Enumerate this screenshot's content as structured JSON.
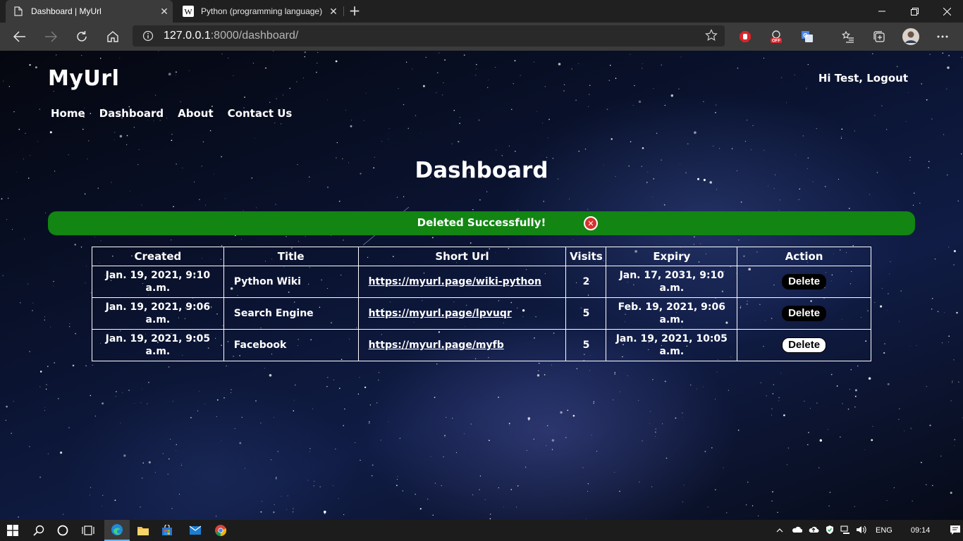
{
  "browser": {
    "tabs": [
      {
        "title": "Dashboard | MyUrl",
        "active": true
      },
      {
        "title": "Python (programming language)",
        "active": false
      }
    ],
    "address": {
      "host": "127.0.0.1",
      "rest": ":8000/dashboard/"
    }
  },
  "site": {
    "brand": "MyUrl",
    "greeting": "Hi Test,",
    "logout": "Logout",
    "nav": [
      {
        "label": "Home"
      },
      {
        "label": "Dashboard"
      },
      {
        "label": "About"
      },
      {
        "label": "Contact Us"
      }
    ]
  },
  "page": {
    "heading": "Dashboard",
    "alert": {
      "message": "Deleted Successfully!",
      "color": "#128513"
    }
  },
  "table": {
    "headers": {
      "created": "Created",
      "title": "Title",
      "short_url": "Short Url",
      "visits": "Visits",
      "expiry": "Expiry",
      "action": "Action"
    },
    "rows": [
      {
        "created": "Jan. 19, 2021, 9:10 a.m.",
        "title": "Python Wiki",
        "short_url": "https://myurl.page/wiki-python",
        "visits": "2",
        "expiry": "Jan. 17, 2031, 9:10 a.m.",
        "action": "Delete"
      },
      {
        "created": "Jan. 19, 2021, 9:06 a.m.",
        "title": "Search Engine",
        "short_url": "https://myurl.page/lpvuqr",
        "visits": "5",
        "expiry": "Feb. 19, 2021, 9:06 a.m.",
        "action": "Delete"
      },
      {
        "created": "Jan. 19, 2021, 9:05 a.m.",
        "title": "Facebook",
        "short_url": "https://myurl.page/myfb",
        "visits": "5",
        "expiry": "Jan. 19, 2021, 10:05 a.m.",
        "action": "Delete"
      }
    ]
  },
  "taskbar": {
    "language": "ENG",
    "time": "09:14"
  },
  "icons": {
    "start": "windows-start-icon",
    "search": "search-icon",
    "cortana": "cortana-icon",
    "taskview": "task-view-icon",
    "edge": "edge-icon",
    "explorer": "file-explorer-icon",
    "store": "store-icon",
    "mail": "mail-icon",
    "chrome": "chrome-icon"
  }
}
